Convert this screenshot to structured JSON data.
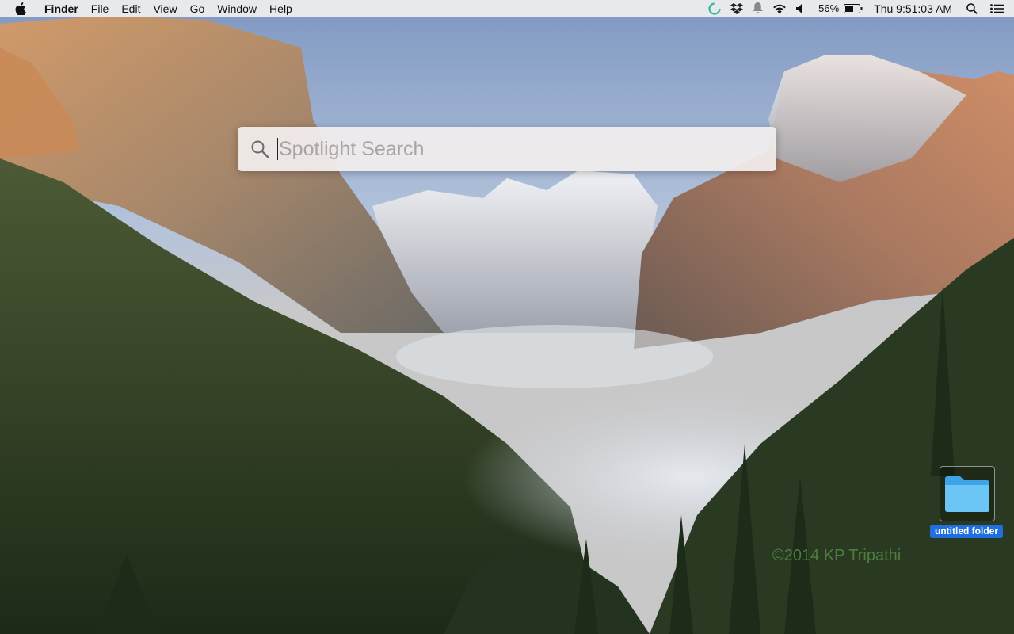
{
  "menubar": {
    "app_name": "Finder",
    "menus": [
      "File",
      "Edit",
      "View",
      "Go",
      "Window",
      "Help"
    ],
    "battery_percent": "56%",
    "clock": "Thu 9:51:03 AM",
    "tray_icons": [
      "focus-app-icon",
      "dropbox-icon",
      "notification-bell-icon",
      "wifi-icon",
      "volume-icon",
      "battery-icon",
      "spotlight-search-icon",
      "notification-center-icon"
    ]
  },
  "spotlight": {
    "placeholder": "Spotlight Search",
    "value": ""
  },
  "desktop": {
    "folder_label": "untitled folder",
    "watermark": "©2014 KP Tripathi"
  },
  "colors": {
    "menubar_bg": "#ececee",
    "selection_blue": "#1f6fdf",
    "folder_blue": "#5ab8ef"
  }
}
